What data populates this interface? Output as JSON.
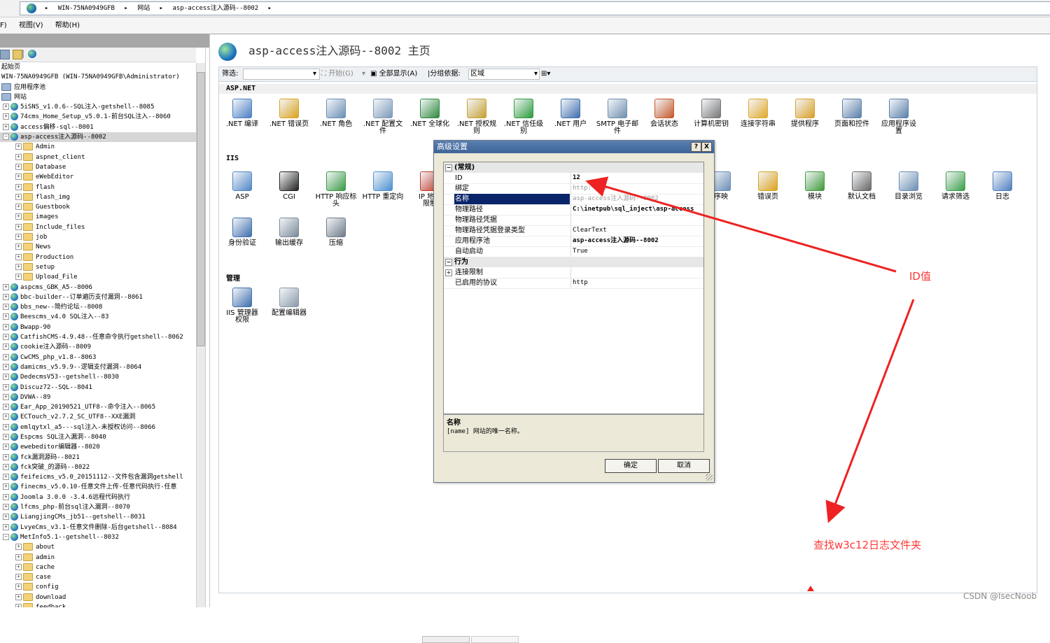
{
  "address_bar": {
    "crumbs": [
      "WIN-75NA0949GFB",
      "网站",
      "asp-access注入源码--8002"
    ]
  },
  "menu": {
    "items": [
      "F)",
      "视图(V)",
      "帮助(H)"
    ]
  },
  "tree": {
    "rows": [
      {
        "label": "起始页",
        "level": 0,
        "type": "none"
      },
      {
        "label": "WIN-75NA0949GFB (WIN-75NA0949GFB\\Administrator)",
        "level": 0,
        "type": "none"
      },
      {
        "label": "应用程序池",
        "level": 0,
        "type": "pool"
      },
      {
        "label": "网站",
        "level": 0,
        "type": "sites"
      },
      {
        "label": "5iSNS_v1.0.6--SQL注入-getshell--8085",
        "level": 1,
        "type": "site"
      },
      {
        "label": "74cms_Home_Setup_v5.0.1-前台SQL注入--8060",
        "level": 1,
        "type": "site"
      },
      {
        "label": "access偏移-sql--8001",
        "level": 1,
        "type": "site"
      },
      {
        "label": "asp-access注入源码--8002",
        "level": 1,
        "type": "site",
        "selected": true
      },
      {
        "label": "Admin",
        "level": 2,
        "type": "folder"
      },
      {
        "label": "aspnet_client",
        "level": 2,
        "type": "folder"
      },
      {
        "label": "Database",
        "level": 2,
        "type": "folder"
      },
      {
        "label": "eWebEditor",
        "level": 2,
        "type": "folder"
      },
      {
        "label": "flash",
        "level": 2,
        "type": "folder"
      },
      {
        "label": "flash_img",
        "level": 2,
        "type": "folder"
      },
      {
        "label": "Guestbook",
        "level": 2,
        "type": "folder"
      },
      {
        "label": "images",
        "level": 2,
        "type": "folder"
      },
      {
        "label": "Include_files",
        "level": 2,
        "type": "folder"
      },
      {
        "label": "job",
        "level": 2,
        "type": "folder"
      },
      {
        "label": "News",
        "level": 2,
        "type": "folder"
      },
      {
        "label": "Production",
        "level": 2,
        "type": "folder"
      },
      {
        "label": "setup",
        "level": 2,
        "type": "folder"
      },
      {
        "label": "Upload_File",
        "level": 2,
        "type": "folder"
      },
      {
        "label": "aspcms_GBK_A5--8006",
        "level": 1,
        "type": "site"
      },
      {
        "label": "bbc-builder--订单遍历支付漏洞--8061",
        "level": 1,
        "type": "site"
      },
      {
        "label": "bbs_new--简约论坛--8008",
        "level": 1,
        "type": "site"
      },
      {
        "label": "Beescms_v4.0 SQL注入--83",
        "level": 1,
        "type": "site"
      },
      {
        "label": "Bwapp-90",
        "level": 1,
        "type": "site"
      },
      {
        "label": "CatfishCMS-4.9.48--任意命令执行getshell--8062",
        "level": 1,
        "type": "site"
      },
      {
        "label": "cookie注入源码--8009",
        "level": 1,
        "type": "site"
      },
      {
        "label": "CwCMS_php_v1.8--8063",
        "level": 1,
        "type": "site"
      },
      {
        "label": "damicms_v5.9.9--逻辑支付漏洞--8064",
        "level": 1,
        "type": "site"
      },
      {
        "label": "DedecmsV53--getshell--8030",
        "level": 1,
        "type": "site"
      },
      {
        "label": "Discuz72--SQL--8041",
        "level": 1,
        "type": "site"
      },
      {
        "label": "DVWA--89",
        "level": 1,
        "type": "site"
      },
      {
        "label": "Ear_App_20190521_UTF8--命令注入--8065",
        "level": 1,
        "type": "site"
      },
      {
        "label": "ECTouch_v2.7.2_SC_UTF8--XXE漏洞",
        "level": 1,
        "type": "site"
      },
      {
        "label": "emlqytxl_a5---sql注入-未授权访问--8066",
        "level": 1,
        "type": "site"
      },
      {
        "label": "Espcms SQL注入漏洞--8040",
        "level": 1,
        "type": "site"
      },
      {
        "label": "ewebeditor编辑器--8020",
        "level": 1,
        "type": "site"
      },
      {
        "label": "fck漏洞源码--8021",
        "level": 1,
        "type": "site"
      },
      {
        "label": "fck突破_的源码--8022",
        "level": 1,
        "type": "site"
      },
      {
        "label": "feifeicms_v5.0_20151112--文件包含漏洞getshell",
        "level": 1,
        "type": "site"
      },
      {
        "label": "finecms_v5.0.10-任意文件上传-任意代码执行-任意",
        "level": 1,
        "type": "site"
      },
      {
        "label": "Joomla 3.0.0 -3.4.6远程代码执行",
        "level": 1,
        "type": "site"
      },
      {
        "label": "lfcms_php-前台sql注入漏洞--8070",
        "level": 1,
        "type": "site"
      },
      {
        "label": "LiangjingCMs_jb51--getshell--8031",
        "level": 1,
        "type": "site"
      },
      {
        "label": "LvyeCms_v3.1-任意文件删除-后台getshell--8084",
        "level": 1,
        "type": "site"
      },
      {
        "label": "MetInfo5.1--getshell--8032",
        "level": 1,
        "type": "site",
        "expanded": true
      },
      {
        "label": "about",
        "level": 2,
        "type": "folder"
      },
      {
        "label": "admin",
        "level": 2,
        "type": "folder"
      },
      {
        "label": "cache",
        "level": 2,
        "type": "folder"
      },
      {
        "label": "case",
        "level": 2,
        "type": "folder"
      },
      {
        "label": "config",
        "level": 2,
        "type": "folder"
      },
      {
        "label": "download",
        "level": 2,
        "type": "folder"
      },
      {
        "label": "feedback",
        "level": 2,
        "type": "folder"
      }
    ]
  },
  "page": {
    "title": "asp-access注入源码--8002 主页"
  },
  "filter": {
    "label": "筛选:",
    "start": "开始(G)",
    "show_all": "全部显示(A)",
    "group_by": "分组依据:",
    "group_value": "区域"
  },
  "sections": {
    "aspnet": "ASP.NET",
    "iis": "IIS",
    "manage": "管理"
  },
  "aspnet_features": [
    {
      "l1": ".NET 编译",
      "l2": "",
      "icon": "net-compile-icon",
      "color": "#4a7fc4"
    },
    {
      "l1": ".NET 错误页",
      "l2": "",
      "icon": "net-error-page-icon",
      "color": "#d9a21c"
    },
    {
      "l1": ".NET 角色",
      "l2": "",
      "icon": "net-roles-icon",
      "color": "#6a8fb5"
    },
    {
      "l1": ".NET 配置文",
      "l2": "件",
      "icon": "net-profile-icon",
      "color": "#7c99b8"
    },
    {
      "l1": ".NET 全球化",
      "l2": "",
      "icon": "net-globalization-icon",
      "color": "#2f8a3d"
    },
    {
      "l1": ".NET 授权规",
      "l2": "则",
      "icon": "net-authorization-icon",
      "color": "#c6a033"
    },
    {
      "l1": ".NET 信任级",
      "l2": "别",
      "icon": "net-trust-level-icon",
      "color": "#2b9a3a"
    },
    {
      "l1": ".NET 用户",
      "l2": "",
      "icon": "net-users-icon",
      "color": "#3f6fae"
    },
    {
      "l1": "SMTP 电子邮",
      "l2": "件",
      "icon": "smtp-email-icon",
      "color": "#6f8fae"
    },
    {
      "l1": "会话状态",
      "l2": "",
      "icon": "session-state-icon",
      "color": "#c45a2a"
    },
    {
      "l1": "计算机密钥",
      "l2": "",
      "icon": "machine-key-icon",
      "color": "#777777"
    },
    {
      "l1": "连接字符串",
      "l2": "",
      "icon": "connection-strings-icon",
      "color": "#e0a92a"
    },
    {
      "l1": "提供程序",
      "l2": "",
      "icon": "providers-icon",
      "color": "#d9a028"
    },
    {
      "l1": "页面和控件",
      "l2": "",
      "icon": "pages-controls-icon",
      "color": "#5b7ea8"
    },
    {
      "l1": "应用程序设",
      "l2": "置",
      "icon": "app-settings-icon",
      "color": "#5a7fa9"
    }
  ],
  "iis_features": [
    {
      "l1": "ASP",
      "l2": "",
      "icon": "asp-icon",
      "color": "#4f86c6"
    },
    {
      "l1": "CGI",
      "l2": "",
      "icon": "cgi-icon",
      "color": "#222222"
    },
    {
      "l1": "HTTP 响应标",
      "l2": "头",
      "icon": "http-headers-icon",
      "color": "#3a9b45"
    },
    {
      "l1": "HTTP 重定向",
      "l2": "",
      "icon": "http-redirect-icon",
      "color": "#4a8fd0"
    },
    {
      "l1": "IP 地址",
      "l2": "限制",
      "icon": "ip-restrictions-icon",
      "color": "#c0392b"
    }
  ],
  "iis_features_right": [
    {
      "l1": "序映",
      "l2": "",
      "icon": "handler-mappings-icon",
      "color": "#6a8fb5"
    },
    {
      "l1": "错误页",
      "l2": "",
      "icon": "error-pages-icon",
      "color": "#d9a21c"
    },
    {
      "l1": "模块",
      "l2": "",
      "icon": "modules-icon",
      "color": "#3f9a3a"
    },
    {
      "l1": "默认文档",
      "l2": "",
      "icon": "default-document-icon",
      "color": "#666666"
    },
    {
      "l1": "目录浏览",
      "l2": "",
      "icon": "directory-browsing-icon",
      "color": "#6b8db3"
    },
    {
      "l1": "请求筛选",
      "l2": "",
      "icon": "request-filtering-icon",
      "color": "#3b9e4a"
    },
    {
      "l1": "日志",
      "l2": "",
      "icon": "logging-icon",
      "color": "#4f7fbf"
    }
  ],
  "iis_features_row2": [
    {
      "l1": "身份验证",
      "l2": "",
      "icon": "authentication-icon",
      "color": "#3f6fae"
    },
    {
      "l1": "输出缓存",
      "l2": "",
      "icon": "output-caching-icon",
      "color": "#7a8a99"
    },
    {
      "l1": "压缩",
      "l2": "",
      "icon": "compression-icon",
      "color": "#6d7b88"
    }
  ],
  "manage_features": [
    {
      "l1": "IIS 管理器",
      "l2": "权限",
      "icon": "iis-manager-permissions-icon",
      "color": "#3f6fae"
    },
    {
      "l1": "配置编辑器",
      "l2": "",
      "icon": "configuration-editor-icon",
      "color": "#8a9aaa"
    }
  ],
  "dialog": {
    "title": "高级设置",
    "help": "?",
    "close": "X",
    "cat_general": "(常规)",
    "rows": [
      {
        "name": "ID",
        "value": "12",
        "bold": true
      },
      {
        "name": "绑定",
        "value": "http:*:80",
        "gray": true
      },
      {
        "name": "名称",
        "value": "asp-access注入源码--8002",
        "selected": true,
        "gray": true
      },
      {
        "name": "物理路径",
        "value": "C:\\inetpub\\sql_inject\\asp-access",
        "bold": true
      },
      {
        "name": "物理路径凭据",
        "value": ""
      },
      {
        "name": "物理路径凭据登录类型",
        "value": "ClearText"
      },
      {
        "name": "应用程序池",
        "value": "asp-access注入源码--8002",
        "bold": true
      },
      {
        "name": "自动启动",
        "value": "True"
      }
    ],
    "cat_behavior": "行为",
    "rows2": [
      {
        "name": "连接限制",
        "value": "",
        "expandable": true
      },
      {
        "name": "已启用的协议",
        "value": "http"
      }
    ],
    "desc_title": "名称",
    "desc_text": "[name] 网站的唯一名称。",
    "ok": "确定",
    "cancel": "取消"
  },
  "annotations": {
    "id_label": "ID值",
    "find_label": "查找w3c12日志文件夹"
  },
  "watermark": "CSDN @IsecNoob"
}
